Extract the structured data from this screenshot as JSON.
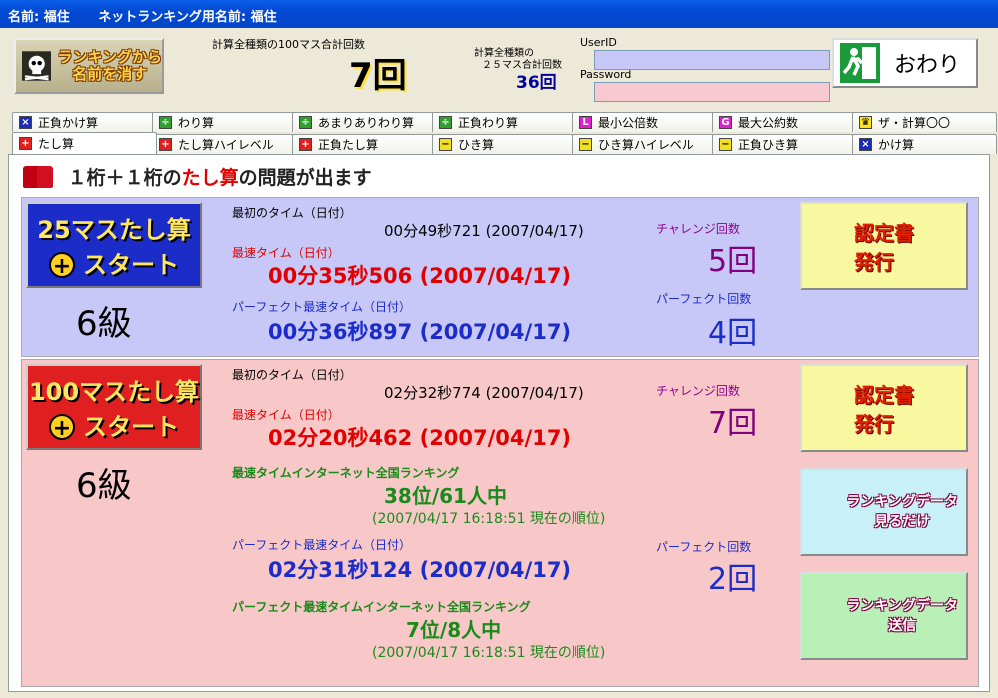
{
  "titlebar": {
    "name": "名前: 福住",
    "net_name": "ネットランキング用名前: 福住"
  },
  "top": {
    "delete_button": "ランキングから\n名前を消す",
    "total100_label": "計算全種類の100マス合計回数",
    "total100_value": "7回",
    "total25_label1": "計算全種類の",
    "total25_label2": "２５マス合計回数",
    "total25_value": "36回",
    "userid_label": "UserID",
    "password_label": "Password",
    "exit_button": "おわり"
  },
  "tabs_row1": [
    {
      "label": "正負かけ算",
      "icon": "×",
      "color": "#1c2cb0"
    },
    {
      "label": "わり算",
      "icon": "÷",
      "color": "#30a030"
    },
    {
      "label": "あまりありわり算",
      "icon": "÷",
      "color": "#30a030"
    },
    {
      "label": "正負わり算",
      "icon": "÷",
      "color": "#30a030"
    },
    {
      "label": "最小公倍数",
      "icon": "L",
      "color": "#e020d0"
    },
    {
      "label": "最大公約数",
      "icon": "G",
      "color": "#e020d0"
    },
    {
      "label": "ザ・計算〇〇",
      "icon": "♛",
      "color": "#ffe020"
    }
  ],
  "tabs_row2": [
    {
      "label": "たし算",
      "icon": "+",
      "color": "#e02020"
    },
    {
      "label": "たし算ハイレベル",
      "icon": "+",
      "color": "#e02020"
    },
    {
      "label": "正負たし算",
      "icon": "+",
      "color": "#e02020"
    },
    {
      "label": "ひき算",
      "icon": "−",
      "color": "#f0e020"
    },
    {
      "label": "ひき算ハイレベル",
      "icon": "−",
      "color": "#f0e020"
    },
    {
      "label": "正負ひき算",
      "icon": "−",
      "color": "#f0e020"
    },
    {
      "label": "かけ算",
      "icon": "×",
      "color": "#1c2cb0"
    }
  ],
  "heading": {
    "pre": "１桁＋１桁の",
    "hi": "たし算",
    "post": "の問題が出ます"
  },
  "sec25": {
    "start_l1": "25マスたし算",
    "start_l2": "スタート",
    "grade": "6級",
    "first_label": "最初のタイム（日付）",
    "first_value": "00分49秒721 (2007/04/17)",
    "best_label": "最速タイム（日付）",
    "best_value": "00分35秒506 (2007/04/17)",
    "perfect_label": "パーフェクト最速タイム（日付）",
    "perfect_value": "00分36秒897 (2007/04/17)",
    "challenge_label": "チャレンジ回数",
    "challenge_value": "5回",
    "perfect_count_label": "パーフェクト回数",
    "perfect_count_value": "4回",
    "cert_button": "認定書\n発行"
  },
  "sec100": {
    "start_l1": "100マスたし算",
    "start_l2": "スタート",
    "grade": "6級",
    "first_label": "最初のタイム（日付）",
    "first_value": "02分32秒774 (2007/04/17)",
    "best_label": "最速タイム（日付）",
    "best_value": "02分20秒462 (2007/04/17)",
    "challenge_label": "チャレンジ回数",
    "challenge_value": "7回",
    "rank_label": "最速タイムインターネット全国ランキング",
    "rank_value": "38位/61人中",
    "rank_time": "(2007/04/17 16:18:51 現在の順位)",
    "perfect_label": "パーフェクト最速タイム（日付）",
    "perfect_value": "02分31秒124 (2007/04/17)",
    "perfect_count_label": "パーフェクト回数",
    "perfect_count_value": "2回",
    "perfect_rank_label": "パーフェクト最速タイムインターネット全国ランキング",
    "perfect_rank_value": "7位/8人中",
    "perfect_rank_time": "(2007/04/17 16:18:51 現在の順位)",
    "cert_button": "認定書\n発行",
    "view_button": "ランキングデータ\n見るだけ",
    "send_button": "ランキングデータ\n送信"
  }
}
